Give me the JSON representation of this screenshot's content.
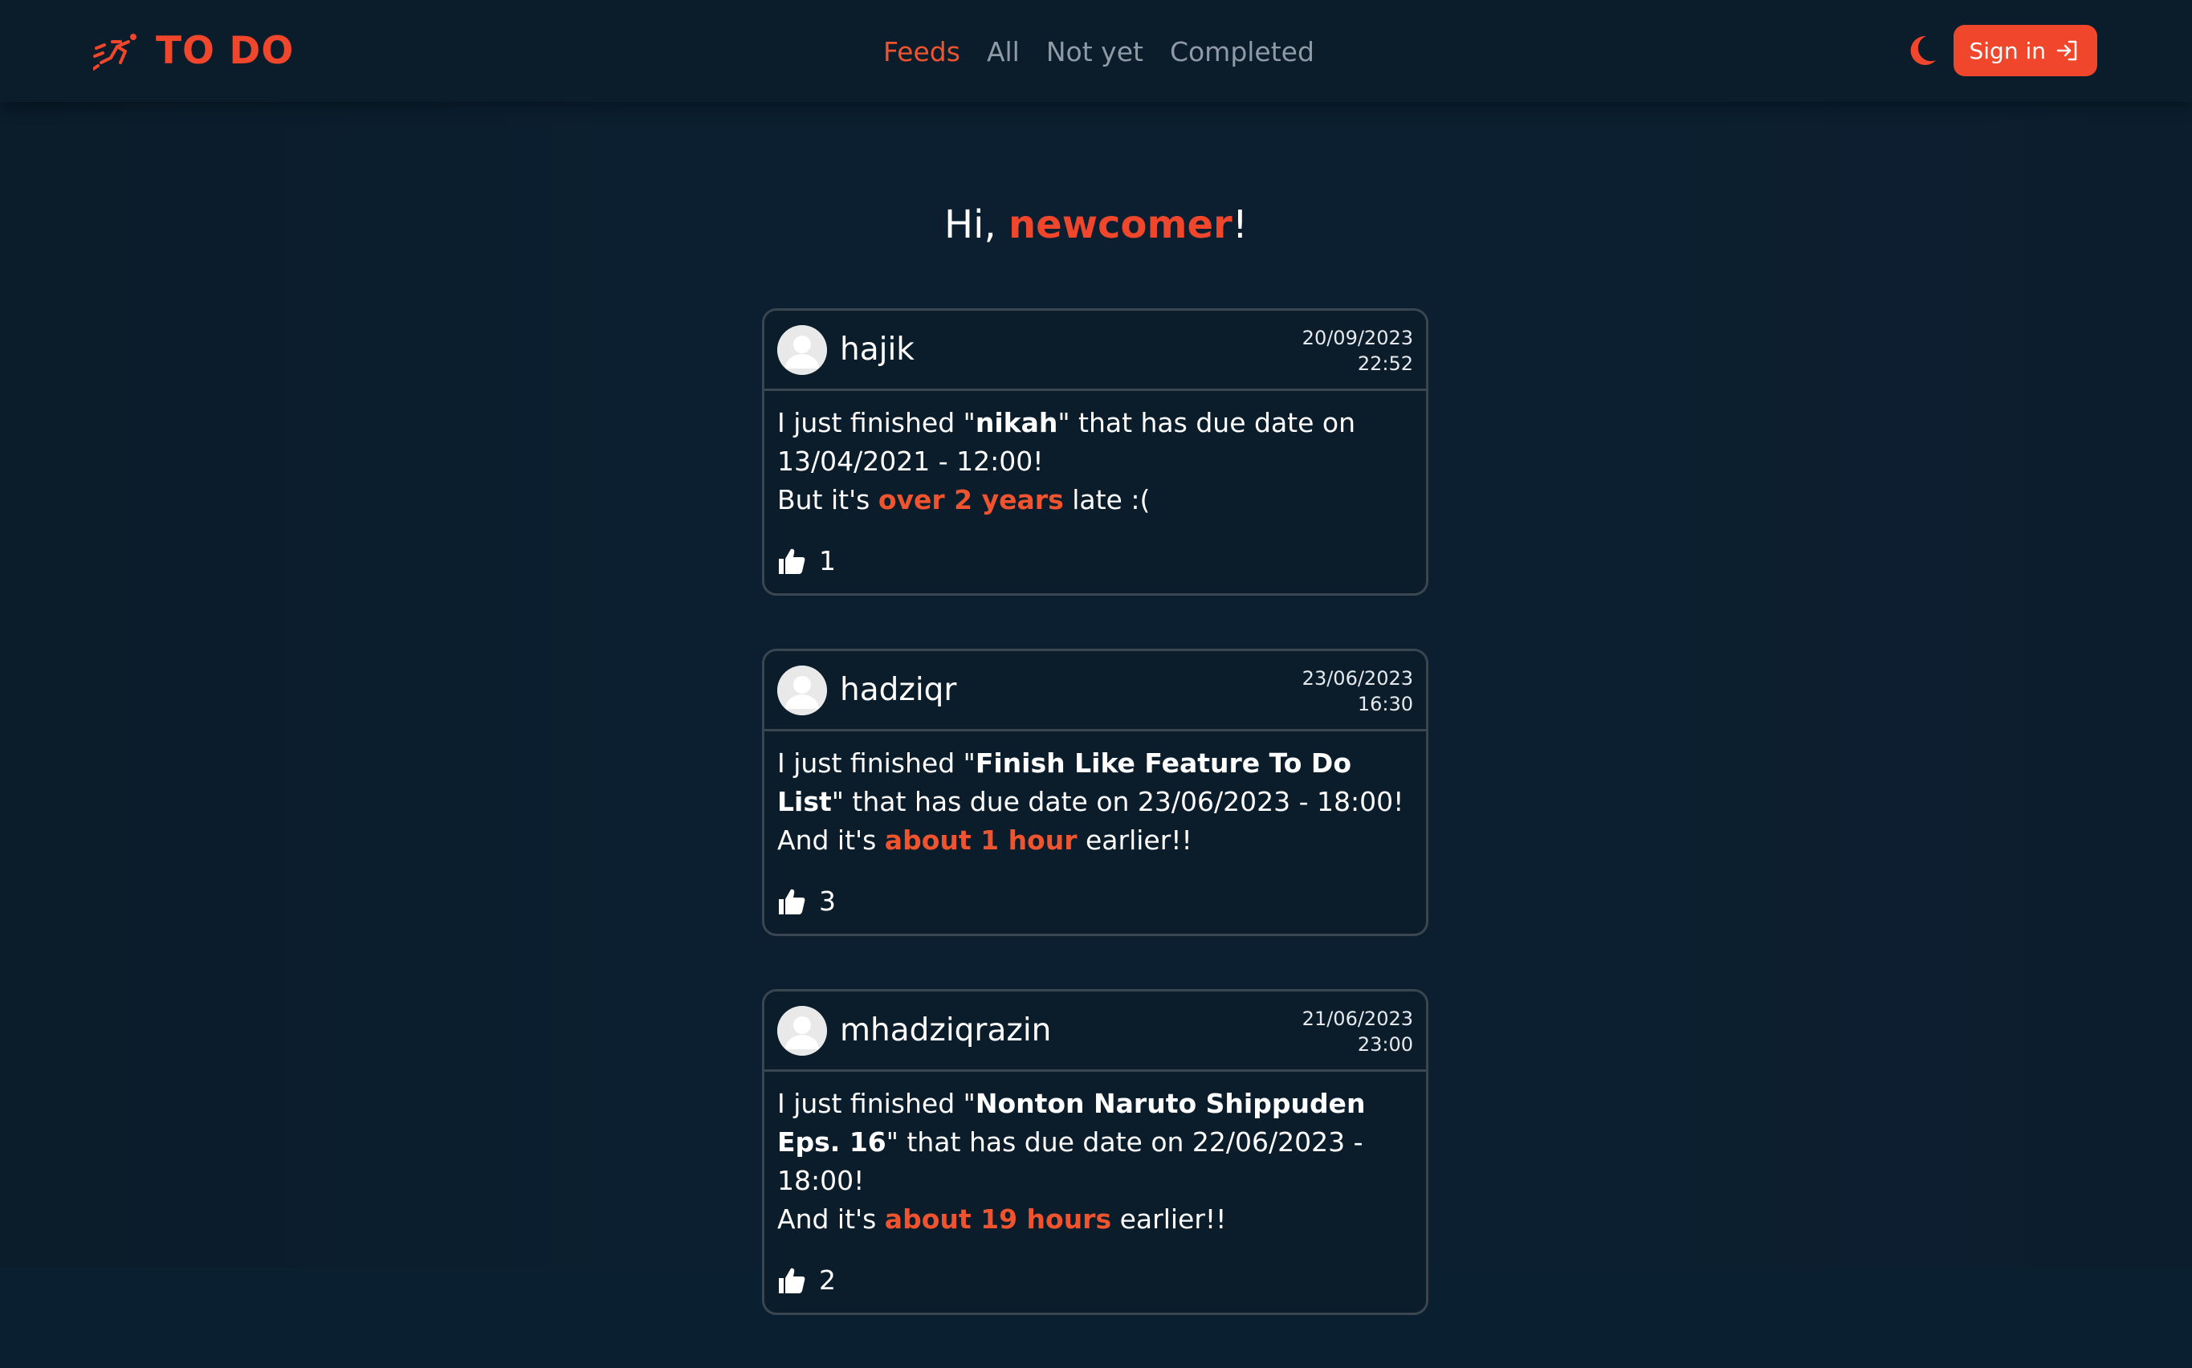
{
  "brand": {
    "title": "TO DO",
    "icon": "running-person-icon",
    "color": "#f0462b"
  },
  "nav": {
    "links": [
      {
        "label": "Feeds",
        "active": true
      },
      {
        "label": "All",
        "active": false
      },
      {
        "label": "Not yet",
        "active": false
      },
      {
        "label": "Completed",
        "active": false
      }
    ]
  },
  "header_right": {
    "theme_icon": "moon-icon",
    "signin_label": "Sign in",
    "signin_icon": "sign-in-icon"
  },
  "greeting": {
    "prefix": "Hi, ",
    "name": "newcomer",
    "suffix": "!"
  },
  "posts": [
    {
      "username": "hajik",
      "date": "20/09/2023",
      "time": "22:52",
      "line1_prefix": "I just finished \"",
      "task": "nikah",
      "line1_suffix": "\" that has due date on 13/04/2021 - 12:00!",
      "line2_prefix": "But it's ",
      "relative": "over 2 years",
      "line2_suffix": " late :(",
      "likes": "1"
    },
    {
      "username": "hadziqr",
      "date": "23/06/2023",
      "time": "16:30",
      "line1_prefix": "I just finished \"",
      "task": "Finish Like Feature To Do List",
      "line1_suffix": "\" that has due date on 23/06/2023 - 18:00!",
      "line2_prefix": "And it's ",
      "relative": "about 1 hour",
      "line2_suffix": " earlier!!",
      "likes": "3"
    },
    {
      "username": "mhadziqrazin",
      "date": "21/06/2023",
      "time": "23:00",
      "line1_prefix": "I just finished \"",
      "task": "Nonton Naruto Shippuden Eps. 16",
      "line1_suffix": "\" that has due date on 22/06/2023 - 18:00!",
      "line2_prefix": "And it's ",
      "relative": "about 19 hours",
      "line2_suffix": " earlier!!",
      "likes": "2"
    }
  ]
}
